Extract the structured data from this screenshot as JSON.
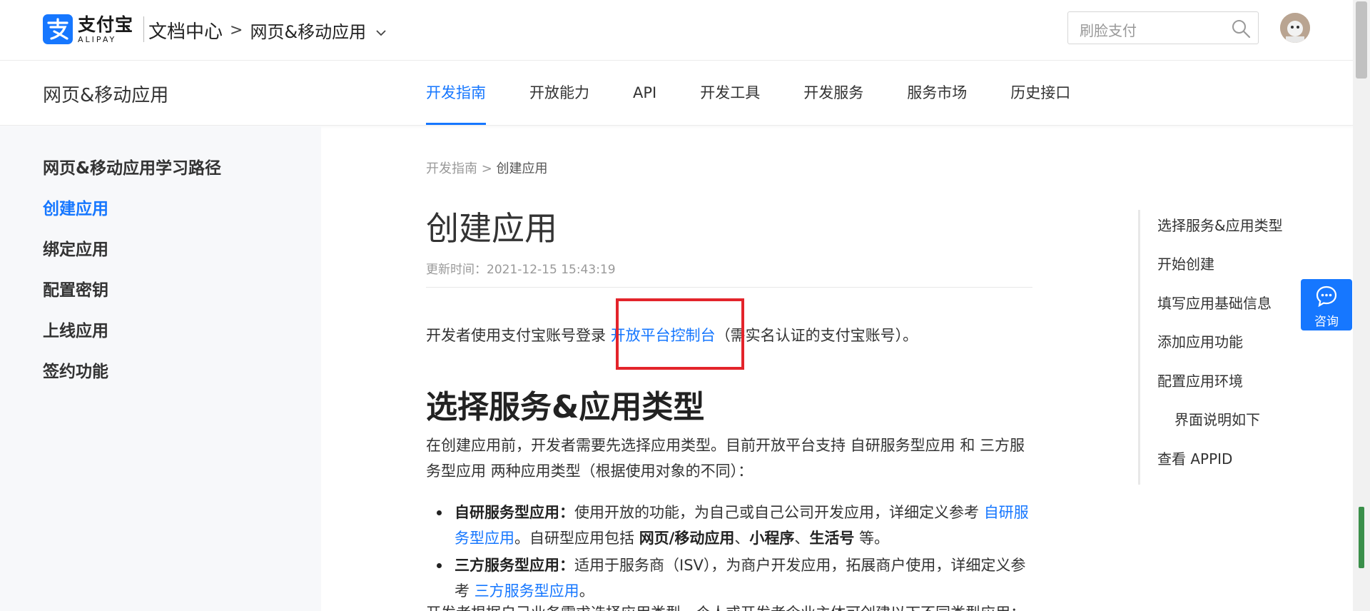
{
  "header": {
    "logo_cn": "支付宝",
    "logo_en": "ALIPAY",
    "doc_center": "文档中心",
    "crumb_sep": ">",
    "product": "网页&移动应用",
    "search_placeholder": "刷脸支付"
  },
  "subnav": {
    "title": "网页&移动应用",
    "tabs": [
      {
        "label": "开发指南",
        "active": true
      },
      {
        "label": "开放能力"
      },
      {
        "label": "API"
      },
      {
        "label": "开发工具"
      },
      {
        "label": "开发服务"
      },
      {
        "label": "服务市场"
      },
      {
        "label": "历史接口"
      }
    ]
  },
  "sidebar": {
    "items": [
      {
        "label": "网页&移动应用学习路径"
      },
      {
        "label": "创建应用",
        "active": true
      },
      {
        "label": "绑定应用"
      },
      {
        "label": "配置密钥"
      },
      {
        "label": "上线应用"
      },
      {
        "label": "签约功能"
      }
    ]
  },
  "content": {
    "breadcrumb_parent": "开发指南",
    "breadcrumb_sep": " > ",
    "breadcrumb_current": "创建应用",
    "title": "创建应用",
    "updated": "更新时间：2021-12-15 15:43:19",
    "intro_before": "开发者使用支付宝账号登录 ",
    "intro_link": "开放平台控制台",
    "intro_after": "（需实名认证的支付宝账号）。",
    "section_title": "选择服务&应用类型",
    "section_para": "在创建应用前，开发者需要先选择应用类型。目前开放平台支持 自研服务型应用 和 三方服务型应用 两种应用类型（根据使用对象的不同）：",
    "bullets": [
      {
        "term": "自研服务型应用：",
        "text": "使用开放的功能，为自己或自己公司开发应用，详细定义参考 ",
        "link": "自研服务型应用",
        "after_link": "。自研型应用包括 ",
        "types": [
          "网页/移动应用",
          "小程序",
          "生活号"
        ],
        "type_sep": "、",
        "tail": " 等。"
      },
      {
        "term": "三方服务型应用：",
        "text": "适用于服务商（ISV），为商户开发应用，拓展商户使用，详细定义参考 ",
        "link": "三方服务型应用",
        "tail": "。"
      }
    ],
    "partial_para": "开发者根据自己业务需求选择应用类型，个人或开发者企业主体可创建以下不同类型应用："
  },
  "toc": {
    "items": [
      {
        "label": "选择服务&应用类型"
      },
      {
        "label": "开始创建"
      },
      {
        "label": "填写应用基础信息"
      },
      {
        "label": "添加应用功能"
      },
      {
        "label": "配置应用环境"
      },
      {
        "label": "界面说明如下",
        "sub": true
      },
      {
        "label": "查看 APPID"
      }
    ]
  },
  "consult": {
    "label": "咨询"
  },
  "colors": {
    "accent": "#1677ff",
    "highlight_box": "#e3242b"
  }
}
